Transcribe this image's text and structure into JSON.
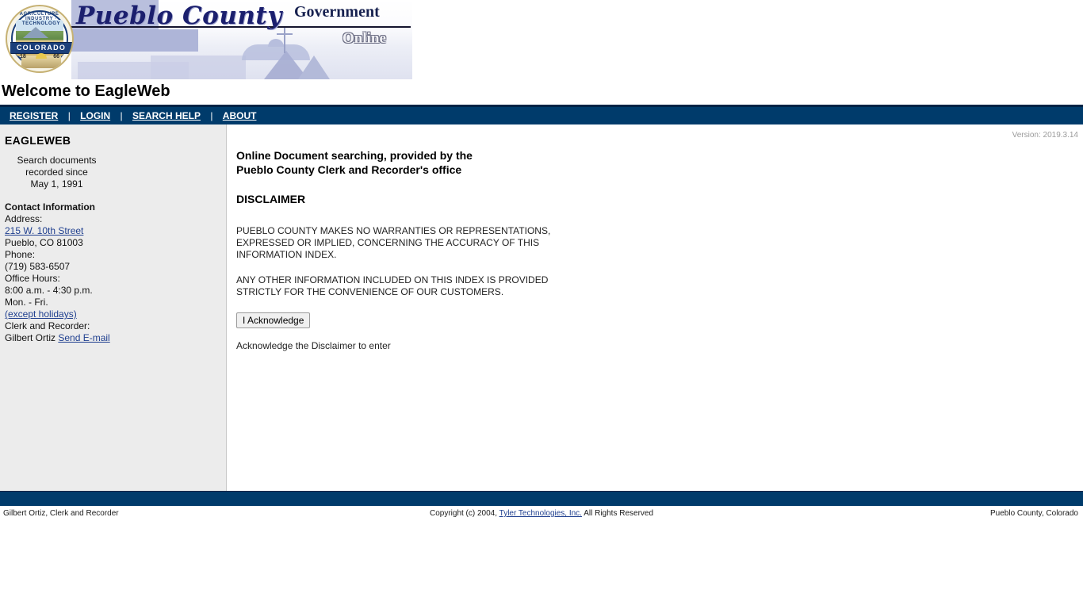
{
  "banner": {
    "county_script": "Pueblo County",
    "government_word": "Government",
    "online_word": "Online",
    "seal": {
      "top_text": "AGRICULTURE · INDUSTRY · TECHNOLOGY",
      "band_text": "COLORADO",
      "year_left": "18",
      "year_right": "66"
    }
  },
  "page_title": "Welcome to EagleWeb",
  "nav": {
    "items": [
      {
        "label": "REGISTER"
      },
      {
        "label": "LOGIN"
      },
      {
        "label": "SEARCH HELP"
      },
      {
        "label": "ABOUT"
      }
    ],
    "separator": "|"
  },
  "sidebar": {
    "heading": "EAGLEWEB",
    "search_since": [
      "Search documents",
      "recorded since",
      "May 1, 1991"
    ],
    "contact": {
      "heading": "Contact Information",
      "address_label": "Address:",
      "address_link": "215 W. 10th Street",
      "city_state_zip": "Pueblo, CO 81003",
      "phone_label": "Phone:",
      "phone": "(719) 583-6507",
      "hours_label": "Office Hours:",
      "hours": "8:00 a.m. - 4:30 p.m.",
      "days": "Mon. - Fri.",
      "holidays_link": "(except holidays)",
      "clerk_label": "Clerk and Recorder:",
      "clerk_name": "Gilbert Ortiz",
      "email_link": "Send E-mail"
    }
  },
  "main": {
    "version": "Version: 2019.3.14",
    "intro_line1": "Online Document searching, provided by the",
    "intro_line2": "Pueblo County Clerk and Recorder's office",
    "disclaimer_title": "DISCLAIMER",
    "disclaimer_p1": "PUEBLO COUNTY MAKES NO WARRANTIES OR REPRESENTATIONS, EXPRESSED OR IMPLIED, CONCERNING THE ACCURACY OF THIS INFORMATION INDEX.",
    "disclaimer_p2": "ANY OTHER INFORMATION INCLUDED ON THIS INDEX IS PROVIDED STRICTLY FOR THE CONVENIENCE OF OUR CUSTOMERS.",
    "acknowledge_button": "I Acknowledge",
    "acknowledge_hint": "Acknowledge the Disclaimer to enter"
  },
  "footer": {
    "left": "Gilbert Ortiz, Clerk and Recorder",
    "copyright_prefix": "Copyright (c) 2004,",
    "copyright_link": "Tyler Technologies, Inc.",
    "copyright_suffix": "All Rights Reserved",
    "right": "Pueblo County, Colorado"
  },
  "colors": {
    "navy": "#003b6b",
    "navy_dark": "#002345",
    "sidebar_bg": "#ececec",
    "link": "#1f3f8f",
    "script_navy": "#1b1f6e",
    "version_gray": "#9b9b9b"
  }
}
